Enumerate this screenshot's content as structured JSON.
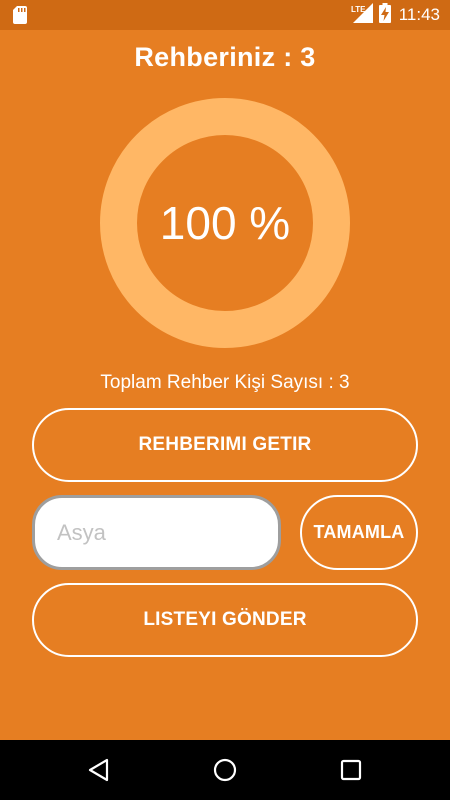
{
  "status_bar": {
    "time": "11:43",
    "network": "LTE",
    "icons": [
      "sd-card-icon",
      "signal-icon",
      "battery-charging-icon"
    ]
  },
  "header": {
    "title": "Rehberiniz : 3"
  },
  "progress": {
    "label": "100 %",
    "fraction": 1.0,
    "ring_color": "#ffb765"
  },
  "summary": {
    "count_text": "Toplam Rehber Kişi Sayısı : 3"
  },
  "buttons": {
    "get_contacts": "REHBERIMI GETIR",
    "complete": "TAMAMLA",
    "send_list": "LISTEYI GÖNDER"
  },
  "name_input": {
    "placeholder": "Asya",
    "value": ""
  },
  "nav_bar": {
    "icons": [
      "back-icon",
      "home-icon",
      "recents-icon"
    ]
  },
  "colors": {
    "background": "#e67e22",
    "status_bar": "#cf6a14",
    "accent": "#ffffff"
  }
}
